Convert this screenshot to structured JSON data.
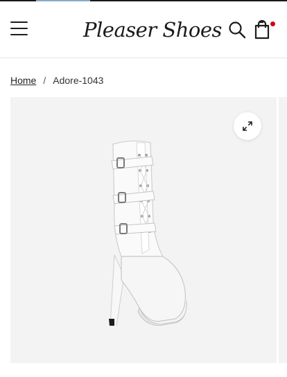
{
  "header": {
    "logo_text": "Pleaser Shoes",
    "cart_badge_color": "#d0021b"
  },
  "icons": {
    "menu": "hamburger-menu-icon",
    "search": "search-icon",
    "cart": "shopping-bag-icon",
    "zoom": "expand-icon"
  },
  "breadcrumb": {
    "home_label": "Home",
    "separator": "/",
    "current": "Adore-1043"
  },
  "product": {
    "image_alt": "White patent lace-up platform ankle boot with three buckle straps"
  },
  "colors": {
    "top_bar": "#1a1a1a",
    "top_bar_accent": "#8aa9c9",
    "gallery_bg": "#f3f3f3"
  }
}
